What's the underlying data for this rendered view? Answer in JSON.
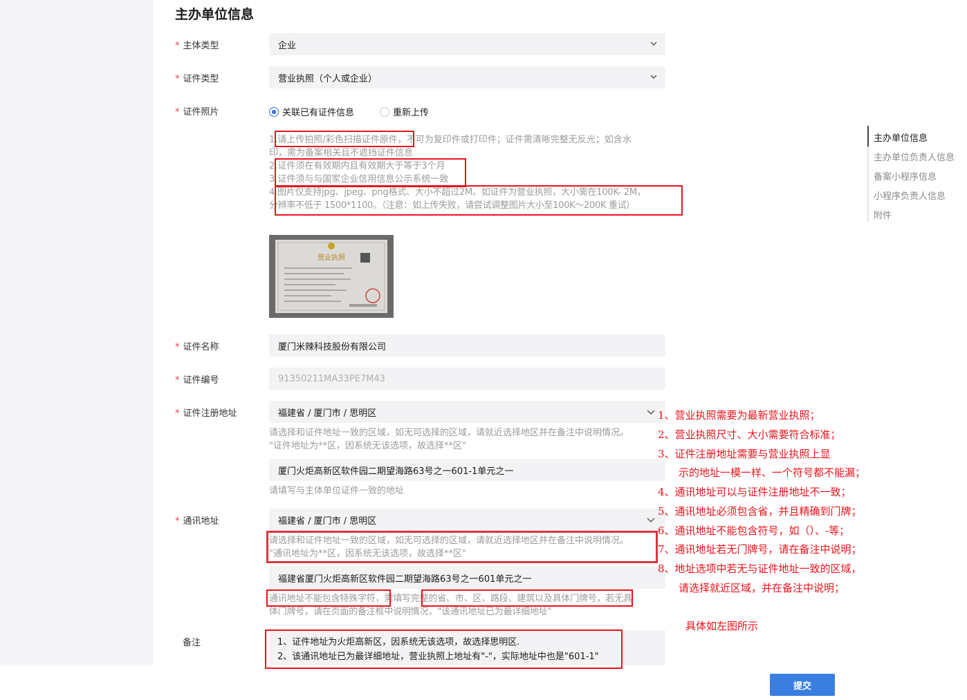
{
  "section_title": "主办单位信息",
  "required_mark": "*",
  "fields": {
    "subject_type": {
      "label": "主体类型",
      "value": "企业"
    },
    "cert_type": {
      "label": "证件类型",
      "value": "营业执照（个人或企业）"
    },
    "cert_photo": {
      "label": "证件照片",
      "options": [
        {
          "label": "关联已有证件信息",
          "selected": true
        },
        {
          "label": "重新上传",
          "selected": false
        }
      ],
      "rules": [
        "1.请上传拍照/彩色扫描证件原件，不可为复印件或打印件；证件需清晰完整无反光；如含水",
        "印，需为备案相关且不遮挡证件信息",
        "2.证件须在有效期内且有效期大于等于3个月",
        "3.证件须与与国家企业信用信息公示系统一致",
        "4.图片仅支持jpg、jpeg、png格式、大小不超过2M。如证件为营业执照，大小需在100K- 2M，",
        "分辨率不低于 1500*1100。（注意：如上传失败，请尝试调整图片大小至100K～200K 重试）"
      ],
      "image_text": "营业执照"
    },
    "cert_name": {
      "label": "证件名称",
      "value": "厦门米辣科技股份有限公司"
    },
    "cert_number": {
      "label": "证件编号",
      "value": "91350211MA33PE7M43"
    },
    "reg_address": {
      "label": "证件注册地址",
      "region": "福建省 / 厦门市 / 思明区",
      "region_hint_1": "请选择和证件地址一致的区域，如无可选择的区域，请就近选择地区并在备注中说明情况。",
      "region_hint_2": "\"证件地址为**区，因系统无该选项，故选择**区\"",
      "detail": "厦门火炬高新区软件园二期望海路63号之一601-1单元之一",
      "detail_hint": "请填写与主体单位证件一致的地址"
    },
    "mail_address": {
      "label": "通讯地址",
      "region": "福建省 / 厦门市 / 思明区",
      "region_hint_1": "请选择和证件地址一致的区域，如无可选择的区域，请就近选择地区并在备注中说明情况。",
      "region_hint_2": "\"通讯地址为**区，因系统无该选项，故选择**区\"",
      "detail": "福建省厦门火炬高新区软件园二期望海路63号之一601单元之一",
      "detail_hint_1": "通讯地址不能包含特殊字符，需填写完整的省、市、区、路段、建筑以及具体门牌号，若无具",
      "detail_hint_2": "体门牌号，请在页面的备注框中说明情况，\"该通讯地址已为最详细地址\""
    },
    "remark": {
      "label": "备注",
      "lines": [
        "1、证件地址为火炬高新区，因系统无该选项，故选择思明区.",
        "2、该通讯地址已为最详细地址，营业执照上地址有\"-\"，实际地址中也是\"601-1\""
      ]
    }
  },
  "sidebar": {
    "items": [
      {
        "label": "主办单位信息",
        "active": true
      },
      {
        "label": "主办单位负责人信息",
        "active": false
      },
      {
        "label": "备案小程序信息",
        "active": false
      },
      {
        "label": "小程序负责人信息",
        "active": false
      },
      {
        "label": "附件",
        "active": false
      }
    ]
  },
  "annotations": {
    "color": "#e8141d",
    "lines": [
      "1、营业执照需要为最新营业执照；",
      "2、营业执照尺寸、大小需要符合标准；",
      "3、证件注册地址需要与营业执照上显",
      "示的地址一模一样、一个符号都不能漏；",
      "4、通讯地址可以与证件注册地址不一致；",
      "5、通讯地址必须包含省，并且精确到门牌；",
      "6、通讯地址不能包含符号，如（）、-等；",
      "7、通讯地址若无门牌号，请在备注中说明；",
      "8、地址选项中若无与证件地址一致的区域，",
      "请选择就近区域，并在备注中说明；"
    ],
    "footer": "具体如左图所示"
  },
  "submit_label": "提交",
  "colors": {
    "primary": "#3a7fe0",
    "required": "#e64340",
    "highlight": "#e8141d"
  }
}
